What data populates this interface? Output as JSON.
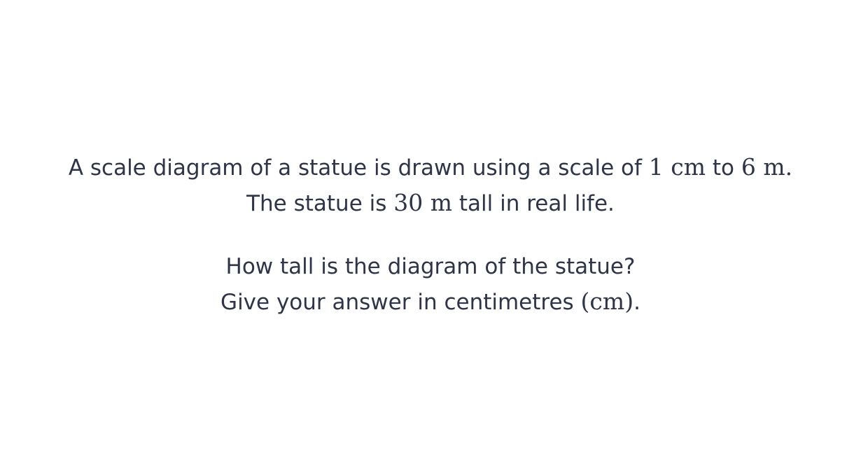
{
  "question": {
    "statement": {
      "line1": {
        "t1": "A scale diagram of a statue is drawn using a scale of ",
        "m1": "1 cm",
        "t2": " to ",
        "m2": "6 m.",
        "t3": ""
      },
      "line2": {
        "t1": "The statue is ",
        "m1": "30 m",
        "t2": " tall in real life."
      }
    },
    "prompt": {
      "line1": "How tall is the diagram of the statue?",
      "line2": {
        "t1": "Give your answer in centimetres ",
        "m1": "(cm)",
        "t2": "."
      }
    }
  }
}
